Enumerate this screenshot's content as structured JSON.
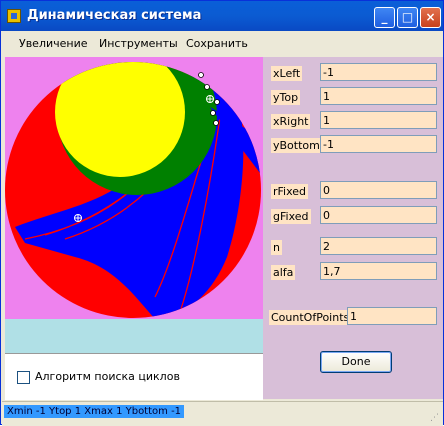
{
  "window": {
    "title": "Динамическая система",
    "minimize_label": "_",
    "maximize_label": "□",
    "close_label": "×"
  },
  "menu": {
    "items": [
      "Увеличение",
      "Инструменты",
      "Сохранить"
    ]
  },
  "canvas": {
    "background_color": "#ee82ee",
    "colors": {
      "red": "#ff0000",
      "blue": "#0000ff",
      "green": "#008000",
      "yellow": "#ffff00"
    }
  },
  "parameters": {
    "xLeft": {
      "label": "xLeft",
      "value": "-1"
    },
    "yTop": {
      "label": "yTop",
      "value": "1"
    },
    "xRight": {
      "label": "xRight",
      "value": "1"
    },
    "yBottom": {
      "label": "yBottom",
      "value": "-1"
    },
    "rFixed": {
      "label": "rFixed",
      "value": "0"
    },
    "gFixed": {
      "label": "gFixed",
      "value": "0"
    },
    "n": {
      "label": "n",
      "value": "2"
    },
    "alfa": {
      "label": "alfa",
      "value": "1,7"
    },
    "countOfPoints": {
      "label": "CountOfPoints",
      "value": "1"
    }
  },
  "done_button": {
    "label": "Done"
  },
  "cycle_search": {
    "label": "Алгоритм поиска циклов",
    "checked": false
  },
  "status": {
    "text": "Xmin -1 Ytop 1 Xmax 1 Ybottom -1"
  }
}
